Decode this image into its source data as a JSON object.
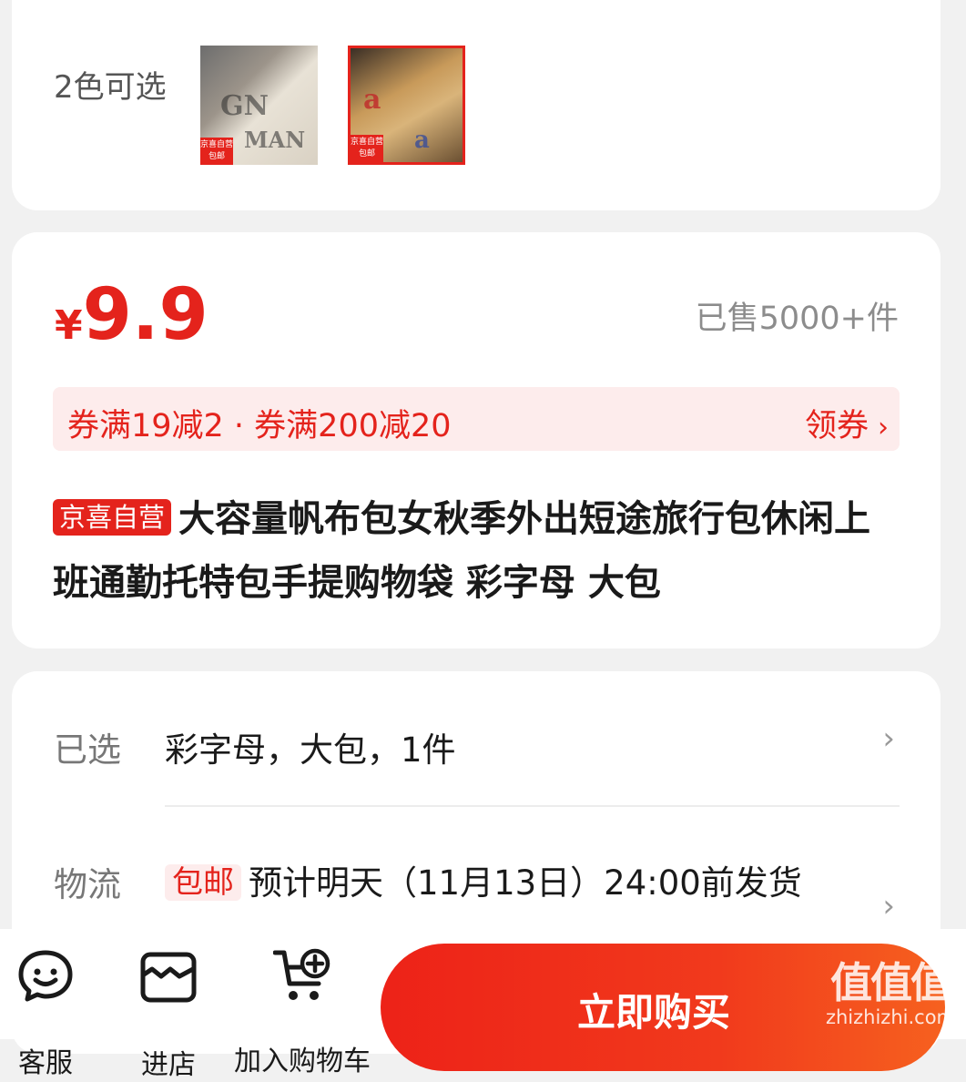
{
  "colors": {
    "label": "2色可选",
    "options": [
      {
        "tag_top": "京喜自营",
        "tag_bottom": "包邮",
        "selected": false
      },
      {
        "tag_top": "京喜自营",
        "tag_bottom": "包邮",
        "selected": true
      }
    ]
  },
  "price": {
    "currency": "¥",
    "amount": "9.9",
    "sold": "已售5000+件"
  },
  "coupon": {
    "text": "券满19减2 · 券满200减20",
    "action": "领券"
  },
  "product": {
    "badge": "京喜自营",
    "title": "大容量帆布包女秋季外出短途旅行包休闲上班通勤托特包手提购物袋 彩字母 大包"
  },
  "spec": {
    "selected_label": "已选",
    "selected_value": "彩字母，大包，1件",
    "logistics_label": "物流",
    "free_shipping": "包邮",
    "logistics_value": "预计明天（11月13日）24:00前发货"
  },
  "bottom": {
    "service": "客服",
    "store": "进店",
    "cart": "加入购物车",
    "buy": "立即购买"
  },
  "watermark": {
    "big": "值值值",
    "small": "zhizhizhi.com"
  },
  "theme": {
    "accent": "#e4231c",
    "page_bg": "#f1f1f1"
  }
}
